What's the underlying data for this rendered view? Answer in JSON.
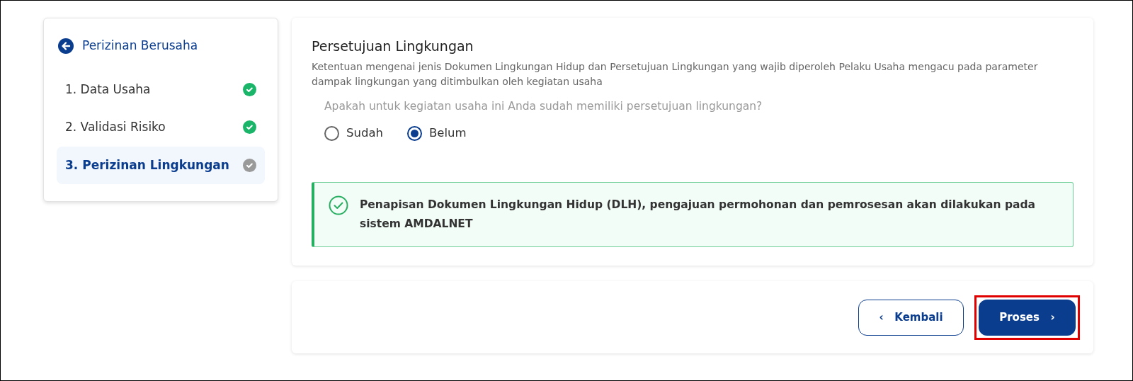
{
  "sidebar": {
    "back_title": "Perizinan Berusaha",
    "steps": [
      {
        "label": "1. Data Usaha",
        "completed": true,
        "selected": false
      },
      {
        "label": "2. Validasi Risiko",
        "completed": true,
        "selected": false
      },
      {
        "label": "3. Perizinan Lingkungan",
        "completed": false,
        "selected": true
      }
    ]
  },
  "section": {
    "title": "Persetujuan Lingkungan",
    "description": "Ketentuan mengenai jenis Dokumen Lingkungan Hidup dan Persetujuan Lingkungan yang wajib diperoleh Pelaku Usaha mengacu pada parameter dampak lingkungan yang ditimbulkan oleh kegiatan usaha",
    "question": "Apakah untuk kegiatan usaha ini Anda sudah memiliki persetujuan lingkungan?",
    "options": [
      {
        "label": "Sudah",
        "selected": false
      },
      {
        "label": "Belum",
        "selected": true
      }
    ],
    "alert": "Penapisan Dokumen Lingkungan Hidup (DLH), pengajuan permohonan dan pemrosesan akan dilakukan pada sistem AMDALNET"
  },
  "footer": {
    "back_button": {
      "label": "Kembali",
      "icon": "‹"
    },
    "next_button": {
      "label": "Proses",
      "icon": "›",
      "highlighted": true
    }
  }
}
